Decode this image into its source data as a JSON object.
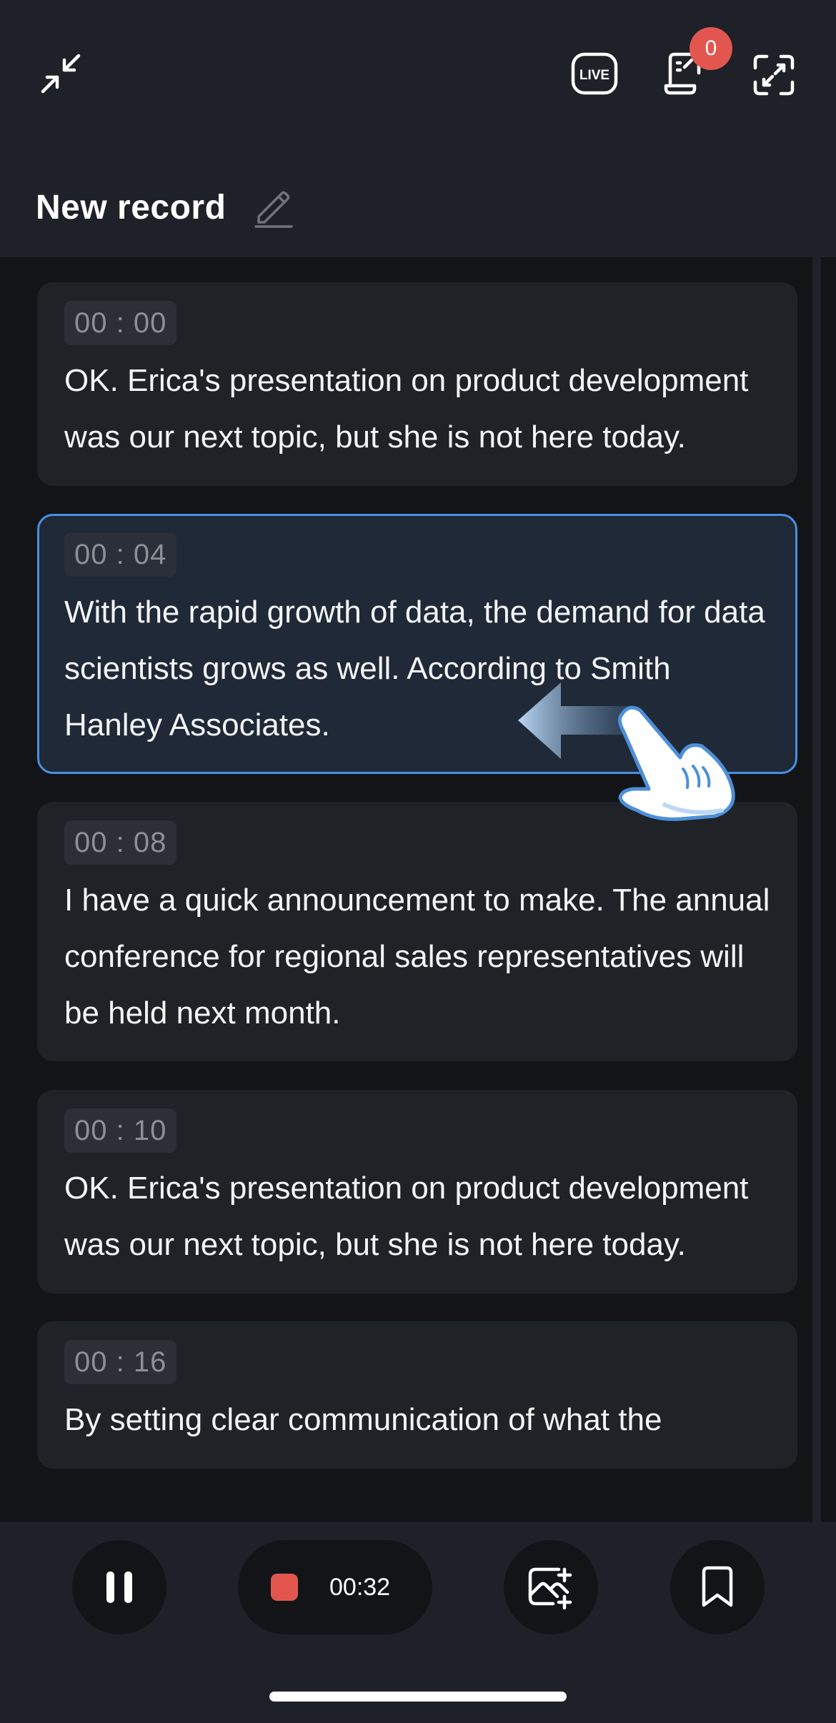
{
  "header": {
    "title": "New record",
    "notification_count": "0",
    "live_label": "LIVE",
    "icons": {
      "collapse": "collapse-arrows-icon",
      "live": "live-icon",
      "notes": "notes-icon",
      "expand": "expand-arrows-icon",
      "edit": "pencil-icon"
    }
  },
  "transcript": [
    {
      "time": "00 : 00",
      "text": "OK. Erica's presentation on product development was our next topic, but she is not here today."
    },
    {
      "time": "00 : 04",
      "text": "With the rapid growth of data, the demand for data scientists grows as well. According to Smith Hanley Associates."
    },
    {
      "time": "00 : 08",
      "text": "I have a quick announcement to make. The annual conference for regional sales representatives will be held next month."
    },
    {
      "time": "00 : 10",
      "text": "OK. Erica's presentation on product development was our next topic, but she is not here today."
    },
    {
      "time": "00 : 16",
      "text": "By setting clear communication of what the"
    }
  ],
  "footer": {
    "record_time": "00:32",
    "icons": {
      "pause": "pause-icon",
      "stop": "stop-icon",
      "add_image": "image-add-icon",
      "bookmark": "bookmark-icon"
    }
  },
  "colors": {
    "background": "#121418",
    "panel": "#1e2127",
    "card": "#1f2227",
    "active_border": "#4a8fe2",
    "badge": "#e3564f",
    "record": "#e3564f"
  },
  "overlay": {
    "gesture": "swipe-left-hand-icon"
  }
}
